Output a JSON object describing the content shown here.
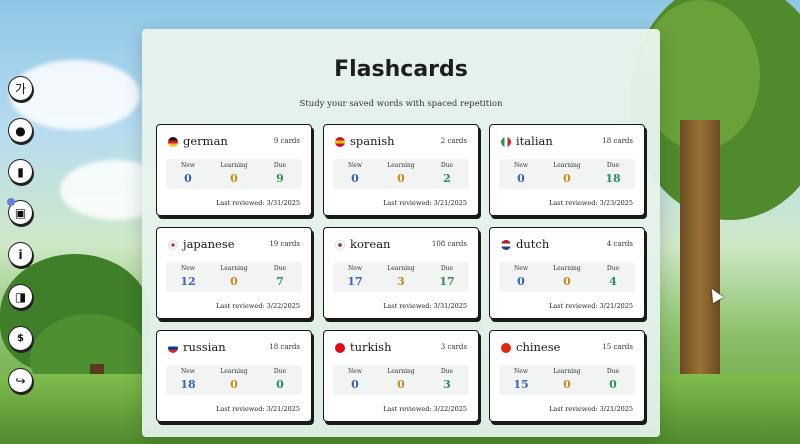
{
  "sidebar": {
    "items": [
      {
        "icon": "hangul-icon",
        "glyph": "가"
      },
      {
        "icon": "user-icon",
        "glyph": "●"
      },
      {
        "icon": "bookmark-icon",
        "glyph": "▮"
      },
      {
        "icon": "flashcards-icon",
        "glyph": "▣"
      },
      {
        "icon": "info-icon",
        "glyph": "i"
      },
      {
        "icon": "chat-icon",
        "glyph": "◨"
      },
      {
        "icon": "coin-icon",
        "glyph": "$"
      },
      {
        "icon": "logout-icon",
        "glyph": "↪"
      }
    ]
  },
  "page": {
    "title": "Flashcards",
    "subtitle": "Study your saved words with spaced repetition"
  },
  "labels": {
    "new": "New",
    "learning": "Learning",
    "due": "Due"
  },
  "decks": [
    {
      "name": "german",
      "cards": "9 cards",
      "new": "0",
      "learning": "0",
      "due": "9",
      "last": "Last reviewed: 3/31/2025",
      "flag": [
        "#111111",
        "#d21f26",
        "#f5c518"
      ]
    },
    {
      "name": "spanish",
      "cards": "2 cards",
      "new": "0",
      "learning": "0",
      "due": "2",
      "last": "Last reviewed: 3/21/2025",
      "flag": [
        "#c8102e",
        "#f4c300",
        "#c8102e"
      ]
    },
    {
      "name": "italian",
      "cards": "18 cards",
      "new": "0",
      "learning": "0",
      "due": "18",
      "last": "Last reviewed: 3/23/2025",
      "flag": [
        "#1e9b46",
        "#ffffff",
        "#d2232a"
      ]
    },
    {
      "name": "japanese",
      "cards": "19 cards",
      "new": "12",
      "learning": "0",
      "due": "7",
      "last": "Last reviewed: 3/22/2025",
      "flag": [
        "#ffffff",
        "#d2232a",
        "#ffffff"
      ]
    },
    {
      "name": "korean",
      "cards": "108 cards",
      "new": "17",
      "learning": "3",
      "due": "17",
      "last": "Last reviewed: 3/31/2025",
      "flag": [
        "#ffffff",
        "#cd2e3a",
        "#0047a0"
      ]
    },
    {
      "name": "dutch",
      "cards": "4 cards",
      "new": "0",
      "learning": "0",
      "due": "4",
      "last": "Last reviewed: 3/21/2025",
      "flag": [
        "#ae1c28",
        "#ffffff",
        "#21468b"
      ]
    },
    {
      "name": "russian",
      "cards": "18 cards",
      "new": "18",
      "learning": "0",
      "due": "0",
      "last": "Last reviewed: 3/21/2025",
      "flag": [
        "#ffffff",
        "#0039a6",
        "#d52b1e"
      ]
    },
    {
      "name": "turkish",
      "cards": "3 cards",
      "new": "0",
      "learning": "0",
      "due": "3",
      "last": "Last reviewed: 3/22/2025",
      "flag": [
        "#e30a17",
        "#e30a17",
        "#e30a17"
      ]
    },
    {
      "name": "chinese",
      "cards": "15 cards",
      "new": "15",
      "learning": "0",
      "due": "0",
      "last": "Last reviewed: 3/21/2025",
      "flag": [
        "#de2910",
        "#de2910",
        "#de2910"
      ]
    }
  ],
  "colors": {
    "new": "#3a62b8",
    "learning": "#c98a18",
    "due": "#2f8f58"
  }
}
